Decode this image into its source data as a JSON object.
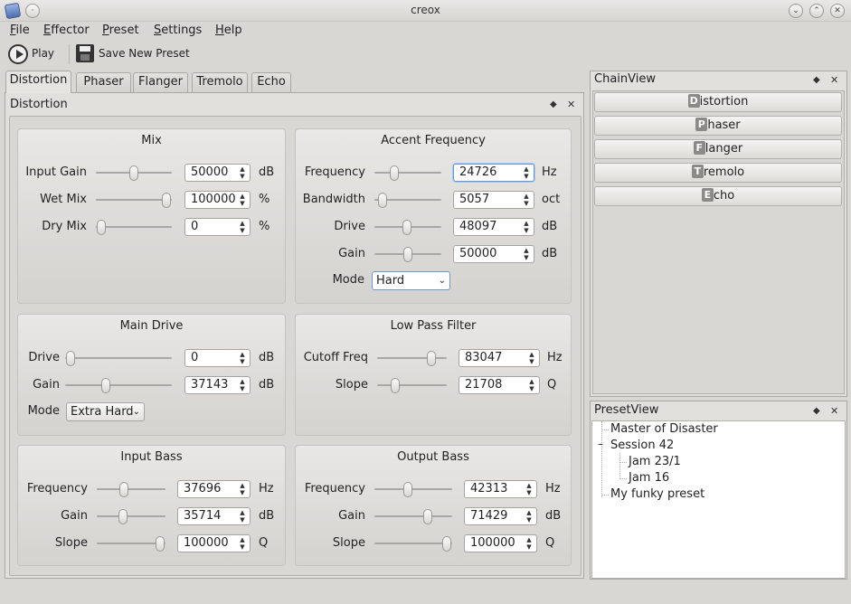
{
  "window": {
    "title": "creox"
  },
  "menu": [
    {
      "label": "File",
      "ul": "F",
      "rest": "ile"
    },
    {
      "label": "Effector",
      "ul": "E",
      "rest": "ffector"
    },
    {
      "label": "Preset",
      "ul": "P",
      "rest": "reset"
    },
    {
      "label": "Settings",
      "ul": "S",
      "rest": "ettings"
    },
    {
      "label": "Help",
      "ul": "H",
      "rest": "elp"
    }
  ],
  "toolbar": {
    "play_label": "Play",
    "save_label": "Save New Preset"
  },
  "tabs": [
    "Distortion",
    "Phaser",
    "Flanger",
    "Tremolo",
    "Echo"
  ],
  "active_tab": "Distortion",
  "dock": {
    "title": "Distortion"
  },
  "groups": {
    "mix": {
      "title": "Mix",
      "input_gain": {
        "label": "Input Gain",
        "value": "50000",
        "unit": "dB",
        "level": 0.5
      },
      "wet_mix": {
        "label": "Wet Mix",
        "value": "100000",
        "unit": "%",
        "level": 1.0
      },
      "dry_mix": {
        "label": "Dry Mix",
        "value": "0",
        "unit": "%",
        "level": 0.0
      }
    },
    "accent": {
      "title": "Accent Frequency",
      "frequency": {
        "label": "Frequency",
        "value": "24726",
        "unit": "Hz",
        "level": 0.25
      },
      "bandwidth": {
        "label": "Bandwidth",
        "value": "5057",
        "unit": "oct",
        "level": 0.05
      },
      "drive": {
        "label": "Drive",
        "value": "48097",
        "unit": "dB",
        "level": 0.48
      },
      "gain": {
        "label": "Gain",
        "value": "50000",
        "unit": "dB",
        "level": 0.5
      },
      "mode": {
        "label": "Mode",
        "value": "Hard"
      }
    },
    "main_drive": {
      "title": "Main Drive",
      "drive": {
        "label": "Drive",
        "value": "0",
        "unit": "dB",
        "level": 0.0
      },
      "gain": {
        "label": "Gain",
        "value": "37143",
        "unit": "dB",
        "level": 0.37
      },
      "mode": {
        "label": "Mode",
        "value": "Extra Hard"
      }
    },
    "lpf": {
      "title": "Low Pass Filter",
      "cutoff": {
        "label": "Cutoff Freq",
        "value": "83047",
        "unit": "Hz",
        "level": 0.83
      },
      "slope": {
        "label": "Slope",
        "value": "21708",
        "unit": "Q",
        "level": 0.22
      }
    },
    "input_bass": {
      "title": "Input Bass",
      "frequency": {
        "label": "Frequency",
        "value": "37696",
        "unit": "Hz",
        "level": 0.38
      },
      "gain": {
        "label": "Gain",
        "value": "35714",
        "unit": "dB",
        "level": 0.36
      },
      "slope": {
        "label": "Slope",
        "value": "100000",
        "unit": "Q",
        "level": 1.0
      }
    },
    "output_bass": {
      "title": "Output Bass",
      "frequency": {
        "label": "Frequency",
        "value": "42313",
        "unit": "Hz",
        "level": 0.42
      },
      "gain": {
        "label": "Gain",
        "value": "71429",
        "unit": "dB",
        "level": 0.71
      },
      "slope": {
        "label": "Slope",
        "value": "100000",
        "unit": "Q",
        "level": 1.0
      }
    }
  },
  "chainview": {
    "title": "ChainView",
    "items": [
      {
        "letter": "D",
        "label": "istortion"
      },
      {
        "letter": "P",
        "label": "haser"
      },
      {
        "letter": "F",
        "label": "langer"
      },
      {
        "letter": "T",
        "label": "remolo"
      },
      {
        "letter": "E",
        "label": "cho"
      }
    ]
  },
  "presetview": {
    "title": "PresetView",
    "items": [
      "Master of Disaster",
      "Session 42",
      "Jam 23/1",
      "Jam 16",
      "My funky preset"
    ]
  },
  "icons": {
    "float": "diamond-icon",
    "close": "close-icon"
  }
}
